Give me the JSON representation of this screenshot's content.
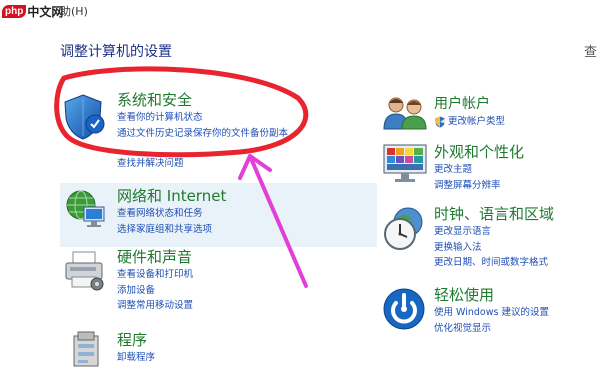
{
  "watermark": {
    "badge": "php",
    "text": "中文网",
    "help_menu": "助(H)"
  },
  "page": {
    "title": "调整计算机的设置",
    "view_label_partial": "查"
  },
  "categories": {
    "system_security": {
      "title": "系统和安全",
      "links": [
        "查看你的计算机状态",
        "通过文件历史记录保存你的文件备份副本",
        "查找并解决问题"
      ]
    },
    "network": {
      "title": "网络和 Internet",
      "links": [
        "查看网络状态和任务",
        "选择家庭组和共享选项"
      ]
    },
    "hardware": {
      "title": "硬件和声音",
      "links": [
        "查看设备和打印机",
        "添加设备",
        "调整常用移动设置"
      ]
    },
    "programs": {
      "title": "程序",
      "links": [
        "卸载程序"
      ]
    },
    "user_accounts": {
      "title": "用户帐户",
      "links": [
        "更改帐户类型"
      ]
    },
    "appearance": {
      "title": "外观和个性化",
      "links": [
        "更改主题",
        "调整屏幕分辨率"
      ]
    },
    "clock": {
      "title": "时钟、语言和区域",
      "links": [
        "更改显示语言",
        "更换输入法",
        "更改日期、时间或数字格式"
      ]
    },
    "ease": {
      "title": "轻松使用",
      "links": [
        "使用 Windows 建议的设置",
        "优化视觉显示"
      ]
    }
  },
  "annotation": {
    "ellipse_color": "#e8242f",
    "arrow_color": "#e23fd8"
  }
}
